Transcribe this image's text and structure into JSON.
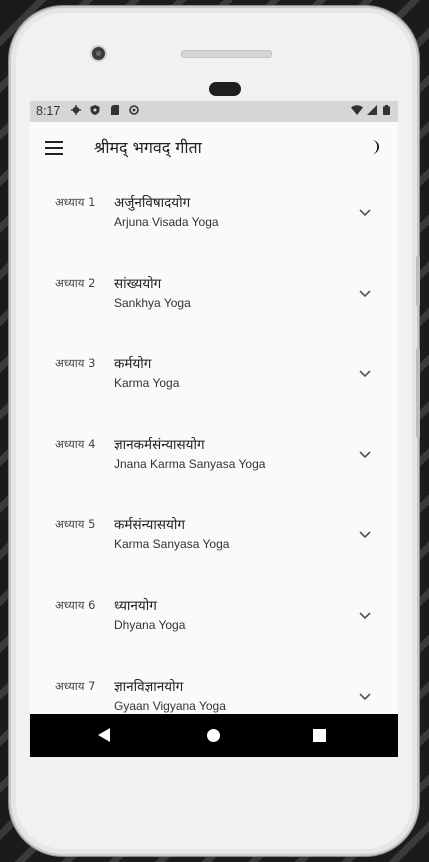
{
  "status": {
    "time": "8:17"
  },
  "appbar": {
    "title": "श्रीमद् भगवद् गीता"
  },
  "chapters": [
    {
      "num": "अध्याय 1",
      "name": "अर्जुनविषादयोग",
      "sub": "Arjuna Visada Yoga"
    },
    {
      "num": "अध्याय 2",
      "name": "सांख्ययोग",
      "sub": "Sankhya Yoga"
    },
    {
      "num": "अध्याय 3",
      "name": "कर्मयोग",
      "sub": "Karma Yoga"
    },
    {
      "num": "अध्याय 4",
      "name": "ज्ञानकर्मसंन्यासयोग",
      "sub": "Jnana Karma Sanyasa Yoga"
    },
    {
      "num": "अध्याय 5",
      "name": "कर्मसंन्यासयोग",
      "sub": "Karma Sanyasa Yoga"
    },
    {
      "num": "अध्याय 6",
      "name": "ध्यानयोग",
      "sub": "Dhyana Yoga"
    },
    {
      "num": "अध्याय 7",
      "name": "ज्ञानविज्ञानयोग",
      "sub": "Gyaan Vigyana Yoga"
    }
  ],
  "icons": {
    "menu": "menu-icon",
    "theme": "moon-icon",
    "expand": "chevron-down-icon",
    "nav_back": "back-triangle-icon",
    "nav_home": "home-circle-icon",
    "nav_recent": "recents-square-icon"
  }
}
